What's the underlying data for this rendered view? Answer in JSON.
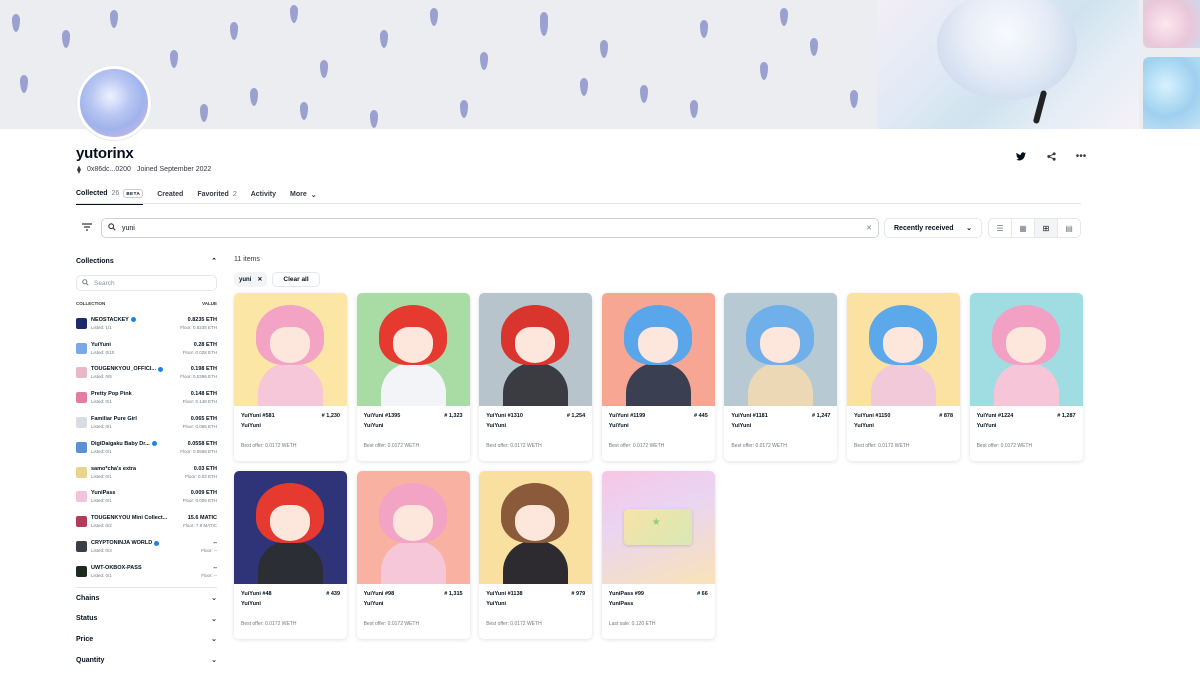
{
  "profile": {
    "username": "yutorinx",
    "address": "0x86dc...0200",
    "joined": "Joined September 2022"
  },
  "tabs": [
    {
      "label": "Collected",
      "count": "26",
      "badge": "BETA"
    },
    {
      "label": "Created",
      "count": "",
      "badge": ""
    },
    {
      "label": "Favorited",
      "count": "2",
      "badge": ""
    },
    {
      "label": "Activity",
      "count": "",
      "badge": ""
    },
    {
      "label": "More",
      "count": "",
      "badge": ""
    }
  ],
  "search": {
    "value": "yuni"
  },
  "sort": {
    "selected": "Recently received"
  },
  "sidebar": {
    "collections_title": "Collections",
    "search_placeholder": "Search",
    "col_collection": "COLLECTION",
    "col_value": "VALUE",
    "collections": [
      {
        "name": "NEOSTACKEY",
        "listed": "Listed: 1/1",
        "value": "0.8235 ETH",
        "floor": "Floor: 0.8235 ETH",
        "verified": true,
        "color": "#1d2b6b"
      },
      {
        "name": "YuiYuni",
        "listed": "Listed: 0/10",
        "value": "0.28 ETH",
        "floor": "Floor: 0.028 ETH",
        "verified": false,
        "color": "#7aa7e6"
      },
      {
        "name": "TOUGENKYOU_OFFICI...",
        "listed": "Listed: 0/5",
        "value": "0.198 ETH",
        "floor": "Floor: 0.0396 ETH",
        "verified": true,
        "color": "#e8b8c8"
      },
      {
        "name": "Pretty Pop Pink",
        "listed": "Listed: 0/1",
        "value": "0.148 ETH",
        "floor": "Floor: 0.148 ETH",
        "verified": false,
        "color": "#e17fa2"
      },
      {
        "name": "Familiar Pure Girl",
        "listed": "Listed: 0/1",
        "value": "0.065 ETH",
        "floor": "Floor: 0.065 ETH",
        "verified": false,
        "color": "#d8dde3"
      },
      {
        "name": "DigiDaigaku Baby Dr...",
        "listed": "Listed: 0/1",
        "value": "0.0558 ETH",
        "floor": "Floor: 0.0558 ETH",
        "verified": true,
        "color": "#5b8fd6"
      },
      {
        "name": "samo*cha's extra",
        "listed": "Listed: 0/1",
        "value": "0.03 ETH",
        "floor": "Floor: 0.03 ETH",
        "verified": false,
        "color": "#e9d48f"
      },
      {
        "name": "YuniPass",
        "listed": "Listed: 0/1",
        "value": "0.009 ETH",
        "floor": "Floor: 0.009 ETH",
        "verified": false,
        "color": "#f1c4dc"
      },
      {
        "name": "TOUGENKYOU Mini Collect...",
        "listed": "Listed: 0/2",
        "value": "15.6 MATIC",
        "floor": "Floor: 7.8 MATIC",
        "verified": false,
        "color": "#b33a5a"
      },
      {
        "name": "CRYPTONINJA WORLD",
        "listed": "Listed: 0/3",
        "value": "--",
        "floor": "Floor: --",
        "verified": true,
        "color": "#3a3f47"
      },
      {
        "name": "UWT-OKBOX-PASS",
        "listed": "Listed: 0/1",
        "value": "--",
        "floor": "Floor: --",
        "verified": false,
        "color": "#1f2a1e"
      }
    ],
    "filters": [
      "Chains",
      "Status",
      "Price",
      "Quantity"
    ]
  },
  "grid": {
    "items_count": "11 items",
    "chip_label": "yuni",
    "clear_all": "Clear all",
    "items": [
      {
        "title": "YuiYuni #581",
        "rank": "# 1,230",
        "collection": "YuiYuni",
        "offer": "Best offer: 0.0172 WETH",
        "bg": "#fbe6a6",
        "hair": "#f3a3c4",
        "outfit": "#f6c7d8"
      },
      {
        "title": "YuiYuni #1395",
        "rank": "# 1,323",
        "collection": "YuiYuni",
        "offer": "Best offer: 0.0172 WETH",
        "bg": "#a9dca4",
        "hair": "#e6392f",
        "outfit": "#f2f4f7"
      },
      {
        "title": "YuiYuni #1310",
        "rank": "# 1,254",
        "collection": "YuiYuni",
        "offer": "Best offer: 0.0172 WETH",
        "bg": "#b7c4cc",
        "hair": "#d9352e",
        "outfit": "#3a3c42"
      },
      {
        "title": "YuiYuni #1199",
        "rank": "# 445",
        "collection": "YuiYuni",
        "offer": "Best offer: 0.0172 WETH",
        "bg": "#f7a694",
        "hair": "#5aa6ea",
        "outfit": "#3b3f52"
      },
      {
        "title": "YuiYuni #1181",
        "rank": "# 1,247",
        "collection": "YuiYuni",
        "offer": "Best offer: 0.0172 WETH",
        "bg": "#b7c9d2",
        "hair": "#6fb0ea",
        "outfit": "#ecd8b5"
      },
      {
        "title": "YuiYuni #1150",
        "rank": "# 878",
        "collection": "YuiYuni",
        "offer": "Best offer: 0.0172 WETH",
        "bg": "#fbe2a2",
        "hair": "#5ba8ea",
        "outfit": "#f2c9d9"
      },
      {
        "title": "YuiYuni #1224",
        "rank": "# 1,287",
        "collection": "YuiYuni",
        "offer": "Best offer: 0.0172 WETH",
        "bg": "#9fdde2",
        "hair": "#f2a0c4",
        "outfit": "#f6c6d8"
      },
      {
        "title": "YuiYuni #48",
        "rank": "# 439",
        "collection": "YuiYuni",
        "offer": "Best offer: 0.0172 WETH",
        "bg": "#2f3377",
        "hair": "#e6392f",
        "outfit": "#2c2e36"
      },
      {
        "title": "YuiYuni #98",
        "rank": "# 1,315",
        "collection": "YuiYuni",
        "offer": "Best offer: 0.0172 WETH",
        "bg": "#f9b2a2",
        "hair": "#f3a3c4",
        "outfit": "#f6c7d8"
      },
      {
        "title": "YuiYuni #1138",
        "rank": "# 979",
        "collection": "YuiYuni",
        "offer": "Best offer: 0.0172 WETH",
        "bg": "#fae0a0",
        "hair": "#8a5a3a",
        "outfit": "#2d2a30"
      },
      {
        "title": "YuniPass #99",
        "rank": "# 66",
        "collection": "YuniPass",
        "offer": "Last sale: 0.120 ETH",
        "bg": "#f3c4e4",
        "hair": "",
        "outfit": ""
      }
    ]
  },
  "colors": {
    "accent": "#2081e2",
    "text": "#04111d",
    "muted": "#707a83"
  }
}
